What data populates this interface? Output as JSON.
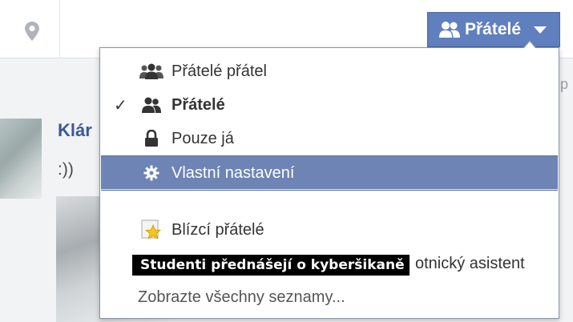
{
  "privacy_button": {
    "label": "Přátelé",
    "icon": "friends-icon"
  },
  "post": {
    "author": "Klár",
    "text": ":))"
  },
  "side_fragment": "p",
  "menu": {
    "items": [
      {
        "label": "Přátelé přátel",
        "icon": "friends-of-friends-icon",
        "selected": false,
        "highlighted": false
      },
      {
        "label": "Přátelé",
        "icon": "friends-icon",
        "selected": true,
        "highlighted": false
      },
      {
        "label": "Pouze já",
        "icon": "lock-icon",
        "selected": false,
        "highlighted": false
      },
      {
        "label": "Vlastní nastavení",
        "icon": "gear-icon",
        "selected": false,
        "highlighted": true
      }
    ],
    "lists": [
      {
        "label": "Blízcí přátelé",
        "icon": "star-icon"
      },
      {
        "label": "otnický asistent",
        "icon": "list-icon"
      }
    ],
    "show_all": "Zobrazte všechny seznamy..."
  },
  "caption": "Studenti přednášejí o kyberšikaně",
  "colors": {
    "accent": "#5f7fbe",
    "highlight": "#6d84b4",
    "link": "#3b5998"
  }
}
